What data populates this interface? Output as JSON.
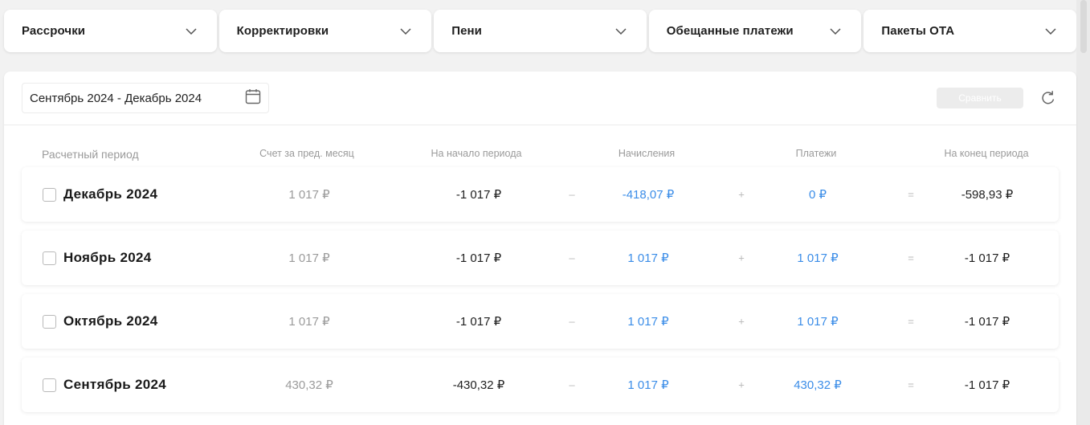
{
  "tabs": [
    {
      "label": "Рассрочки"
    },
    {
      "label": "Корректировки"
    },
    {
      "label": "Пени"
    },
    {
      "label": "Обещанные платежи"
    },
    {
      "label": "Пакеты ОТА"
    }
  ],
  "toolbar": {
    "date_range": "Сентябрь 2024 - Декабрь 2024",
    "compare_label": "Сравнить",
    "compare_enabled": false
  },
  "columns": {
    "period": "Расчетный период",
    "prev_bill": "Счет за пред. месяц",
    "start": "На начало периода",
    "charges": "Начисления",
    "payments": "Платежи",
    "end": "На конец периода"
  },
  "operators": {
    "minus": "–",
    "plus": "+",
    "equals": "="
  },
  "rows": [
    {
      "period": "Декабрь 2024",
      "prev_bill": "1 017 ₽",
      "start": "-1 017 ₽",
      "charges": "-418,07 ₽",
      "payments": "0 ₽",
      "end": "-598,93 ₽",
      "checked": false
    },
    {
      "period": "Ноябрь 2024",
      "prev_bill": "1 017 ₽",
      "start": "-1 017 ₽",
      "charges": "1 017 ₽",
      "payments": "1 017 ₽",
      "end": "-1 017 ₽",
      "checked": false
    },
    {
      "period": "Октябрь 2024",
      "prev_bill": "1 017 ₽",
      "start": "-1 017 ₽",
      "charges": "1 017 ₽",
      "payments": "1 017 ₽",
      "end": "-1 017 ₽",
      "checked": false
    },
    {
      "period": "Сентябрь 2024",
      "prev_bill": "430,32 ₽",
      "start": "-430,32 ₽",
      "charges": "1 017 ₽",
      "payments": "430,32 ₽",
      "end": "-1 017 ₽",
      "checked": false
    }
  ],
  "colors": {
    "accent_blue": "#3b8de8",
    "muted_gray": "#9b9b9b"
  },
  "icons": {
    "dropdown": "chevron-down-icon",
    "calendar": "calendar-icon",
    "refresh": "refresh-icon"
  }
}
